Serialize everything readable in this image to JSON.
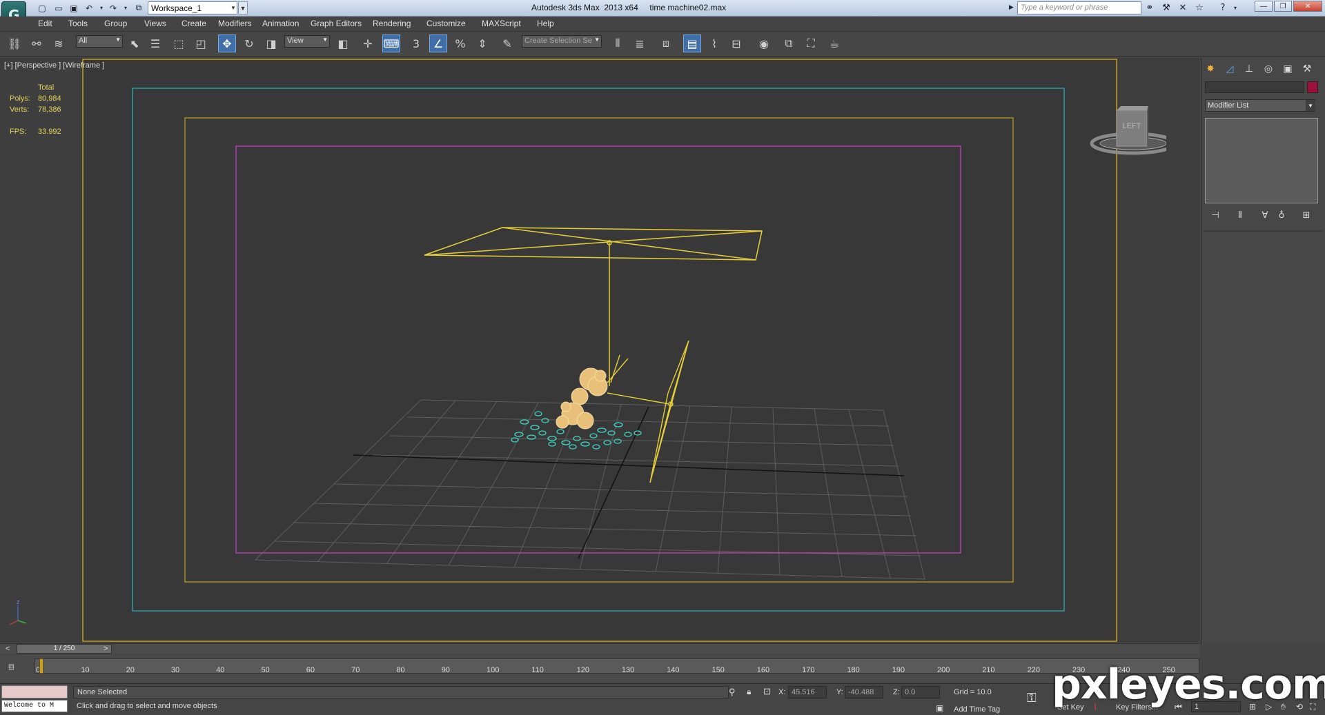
{
  "window": {
    "workspace": "Workspace_1",
    "app_title": "Autodesk 3ds Max  2013 x64     time machine02.max",
    "search_placeholder": "Type a keyword or phrase"
  },
  "menu": [
    "Edit",
    "Tools",
    "Group",
    "Views",
    "Create",
    "Modifiers",
    "Animation",
    "Graph Editors",
    "Rendering",
    "Customize",
    "MAXScript",
    "Help"
  ],
  "toolbar": {
    "selection_filter": "All",
    "ref_coord": "View",
    "named_selection": "Create Selection Se",
    "snap_3": "3",
    "snap_percent": "%"
  },
  "viewport": {
    "label": "[+] [Perspective ] [Wireframe ]",
    "stats": {
      "total_label": "Total",
      "polys_label": "Polys:",
      "polys": "80,984",
      "verts_label": "Verts:",
      "verts": "78,386",
      "fps_label": "FPS:",
      "fps": "33.992"
    },
    "viewcube_label": "LEFT",
    "axis_z": "z"
  },
  "command_panel": {
    "modifier_list": "Modifier List",
    "swatch_color": "#a0103c"
  },
  "timeline": {
    "frame_counter": "1 / 250",
    "ticks": [
      "0",
      "10",
      "20",
      "30",
      "40",
      "50",
      "60",
      "70",
      "80",
      "90",
      "100",
      "110",
      "120",
      "130",
      "140",
      "150",
      "160",
      "170",
      "180",
      "190",
      "200",
      "210",
      "220",
      "230",
      "240",
      "250"
    ]
  },
  "status": {
    "maxscript": "Welcome to M",
    "selection": "None Selected",
    "prompt": "Click and drag to select and move objects",
    "x_label": "X:",
    "x": "45.516",
    "y_label": "Y:",
    "y": "-40.488",
    "z_label": "Z:",
    "z": "0.0",
    "grid": "Grid = 10.0",
    "add_time_tag": "Add Time Tag",
    "set_key": "Set Key",
    "key_filters": "Key Filters...",
    "current_frame": "1"
  },
  "watermark": "pxleyes.com",
  "colors": {
    "safe_frame_outer": "#2bb3c0",
    "safe_frame_mid": "#c8a020",
    "safe_frame_inner": "#d03cd0",
    "wire_yellow": "#e6cf3a",
    "particles_cyan": "#3fd6c6"
  }
}
